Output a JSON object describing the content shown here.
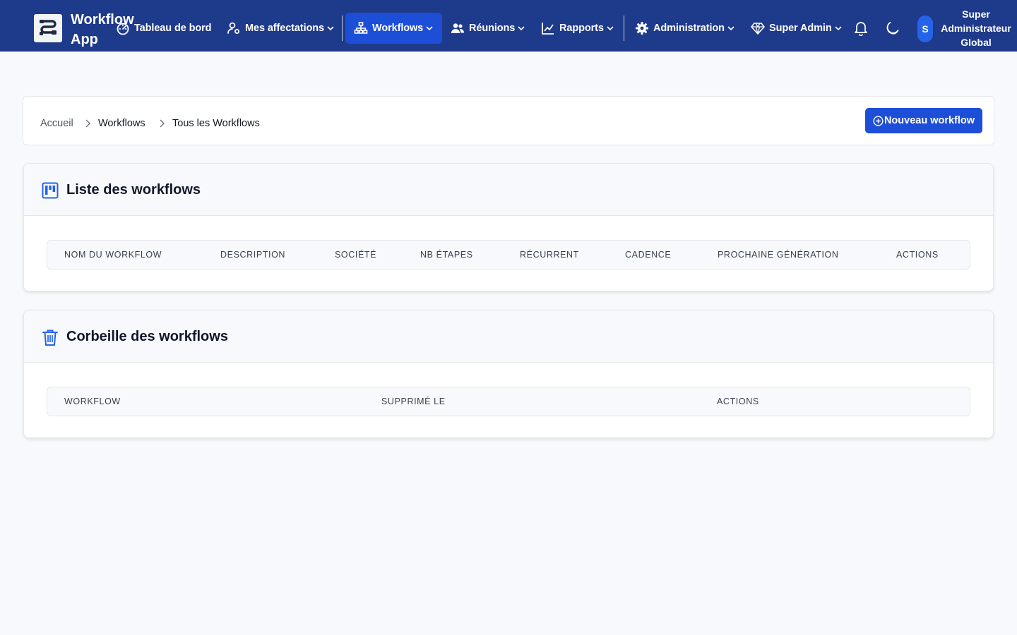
{
  "app": {
    "name_line1": "Workflow",
    "name_line2": "App"
  },
  "nav": {
    "dashboard": "Tableau de bord",
    "assignments": "Mes affectations",
    "workflows": "Workflows",
    "meetings": "Réunions",
    "reports": "Rapports",
    "administration": "Administration",
    "super_admin": "Super Admin"
  },
  "user": {
    "initial": "S",
    "name_line1": "Super",
    "name_line2": "Administrateur",
    "name_line3": "Global"
  },
  "breadcrumb": {
    "home": "Accueil",
    "section": "Workflows",
    "current": "Tous les Workflows"
  },
  "actions": {
    "new_workflow": "Nouveau workflow"
  },
  "workflow_list": {
    "title": "Liste des workflows",
    "columns": [
      "NOM DU WORKFLOW",
      "DESCRIPTION",
      "SOCIÉTÉ",
      "NB ÉTAPES",
      "RÉCURRENT",
      "CADENCE",
      "PROCHAINE GÉNÉRATION",
      "ACTIONS"
    ],
    "rows": []
  },
  "trash": {
    "title": "Corbeille des workflows",
    "columns": [
      "WORKFLOW",
      "SUPPRIMÉ LE",
      "ACTIONS"
    ],
    "rows": []
  },
  "colors": {
    "navbar": "#1e3a8a",
    "accent": "#1d4ed8",
    "background": "#f8f9fc"
  },
  "icons": {
    "logo": "workflow-logo-icon",
    "dashboard": "gauge-icon",
    "assignments": "user-gear-icon",
    "workflows": "sitemap-icon",
    "meetings": "users-icon",
    "reports": "chart-line-icon",
    "administration": "gear-icon",
    "super_admin": "gem-icon",
    "notifications": "bell-icon",
    "theme": "moon-icon",
    "list": "kanban-icon",
    "trash": "trash-icon",
    "add": "plus-circle-icon"
  }
}
